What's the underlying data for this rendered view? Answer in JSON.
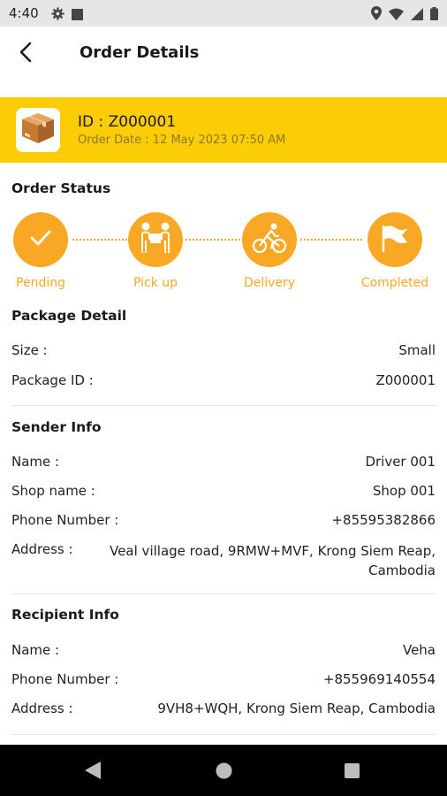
{
  "status_bar": {
    "time": "4:40"
  },
  "header": {
    "title": "Order Details"
  },
  "order": {
    "id_label": "ID  : Z000001",
    "date_label": "Order Date  : 12 May 2023  07:50 AM"
  },
  "order_status": {
    "title": "Order Status",
    "steps": [
      {
        "label": "Pending",
        "icon": "check-icon"
      },
      {
        "label": "Pick up",
        "icon": "pickup-handover-icon"
      },
      {
        "label": "Delivery",
        "icon": "cyclist-icon"
      },
      {
        "label": "Completed",
        "icon": "flag-icon"
      }
    ]
  },
  "package": {
    "title": "Package Detail",
    "size_label": "Size :",
    "size_value": "Small",
    "id_label": "Package ID :",
    "id_value": "Z000001"
  },
  "sender": {
    "title": "Sender Info",
    "name_label": "Name :",
    "name_value": "Driver 001",
    "shop_label": "Shop name :",
    "shop_value": "Shop 001",
    "phone_label": "Phone Number :",
    "phone_value": "+85595382866",
    "address_label": "Address :",
    "address_value": "Veal village road, 9RMW+MVF, Krong Siem Reap, Cambodia"
  },
  "recipient": {
    "title": "Recipient Info",
    "name_label": "Name :",
    "name_value": "Veha",
    "phone_label": "Phone Number :",
    "phone_value": "+855969140554",
    "address_label": "Address :",
    "address_value": "9VH8+WQH, Krong Siem Reap, Cambodia"
  },
  "colors": {
    "banner": "#fccc06",
    "accent": "#f9a825",
    "nav_bar": "#000000",
    "status_bar": "#e6e6e6"
  }
}
